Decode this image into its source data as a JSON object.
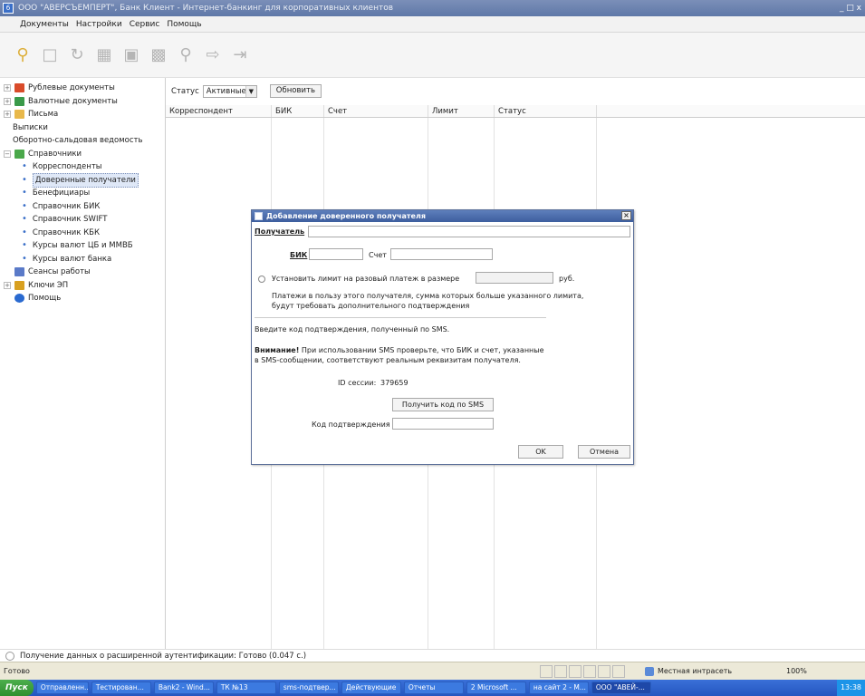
{
  "window": {
    "title": "ООО \"АВЕРСЪЕМПЕРТ\", Банк Клиент - Интернет-банкинг для корпоративных клиентов",
    "controls": "_ □ x"
  },
  "menu": [
    "Документы",
    "Настройки",
    "Сервис",
    "Помощь"
  ],
  "toolbar_icons": [
    "key-icon",
    "document-icon",
    "refresh-icon",
    "archive-icon",
    "delete-icon",
    "print-icon",
    "search-icon",
    "export-icon",
    "import-icon"
  ],
  "tree": {
    "items": [
      {
        "label": "Рублевые документы",
        "icon": "rub-docs-icon",
        "expander": "+"
      },
      {
        "label": "Валютные документы",
        "icon": "currency-docs-icon",
        "expander": "+"
      },
      {
        "label": "Письма",
        "icon": "mail-icon",
        "expander": "+"
      },
      {
        "label": "Выписки",
        "icon": "",
        "expander": ""
      },
      {
        "label": "Оборотно-сальдовая ведомость",
        "icon": "",
        "expander": ""
      },
      {
        "label": "Справочники",
        "icon": "reference-icon",
        "expander": "−"
      }
    ],
    "children": [
      {
        "label": "Корреспонденты"
      },
      {
        "label": "Доверенные получатели",
        "selected": true
      },
      {
        "label": "Бенефициары"
      },
      {
        "label": "Справочник БИК"
      },
      {
        "label": "Справочник SWIFT"
      },
      {
        "label": "Справочник КБК"
      },
      {
        "label": "Курсы валют ЦБ и ММВБ"
      },
      {
        "label": "Курсы валют банка"
      }
    ],
    "after": [
      {
        "label": "Сеансы работы",
        "icon": "sessions-icon",
        "expander": ""
      },
      {
        "label": "Ключи ЭП",
        "icon": "keys-icon",
        "expander": "+"
      },
      {
        "label": "Помощь",
        "icon": "help-icon",
        "expander": ""
      }
    ]
  },
  "filter": {
    "status_label": "Статус",
    "status_value": "Активные",
    "refresh_label": "Обновить"
  },
  "grid": {
    "columns": [
      "Корреспондент",
      "БИК",
      "Счет",
      "Лимит",
      "Статус"
    ]
  },
  "dialog": {
    "title": "Добавление доверенного получателя",
    "recipient_label": "Получатель",
    "bik_label": "БИК",
    "account_label": "Счет",
    "limit_checkbox_label": "Установить лимит на разовый платеж в размере",
    "currency": "руб.",
    "limit_note_1": "Платежи в пользу этого получателя, сумма которых больше указанного лимита,",
    "limit_note_2": "будут требовать дополнительного подтверждения",
    "sms_prompt": "Введите код подтверждения, полученный по SMS.",
    "warning_bold": "Внимание!",
    "warning_text": " При использовании SMS проверьте, что БИК и счет, указанные",
    "warning_text_2": "в SMS-сообщении, соответствуют реальным реквизитам получателя.",
    "session_label": "ID сессии:",
    "session_id": "379659",
    "get_code_button": "Получить код по SMS",
    "confirm_label": "Код подтверждения",
    "ok_button": "OK",
    "cancel_button": "Отмена"
  },
  "statusline": "Получение данных о расширенной аутентификации: Готово (0.047 с.)",
  "appstatus": {
    "left": "Готово",
    "zone": "Местная интрасеть",
    "zoom": "100%"
  },
  "taskbar": {
    "start": "Пуск",
    "tasks": [
      "Отправленн...",
      "Тестирован...",
      "Bank2 - Wind...",
      "ТК №13",
      "sms-подтвер...",
      "Действующие",
      "Отчеты",
      "2 Microsoft ...",
      "на сайт 2 - М...",
      "ООО \"АВЕЙ-..."
    ],
    "clock": "13:38"
  }
}
